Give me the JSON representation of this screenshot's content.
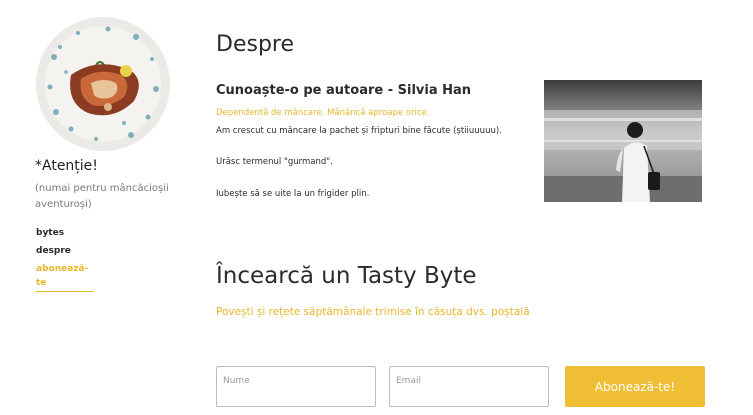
{
  "sidebar": {
    "brand": "*Atenție!",
    "tagline": "(numai pentru mâncăcioșii aventuroși)",
    "nav": [
      {
        "label": "bytes"
      },
      {
        "label": "despre"
      },
      {
        "label": "abonează-te"
      }
    ]
  },
  "about": {
    "title": "Despre",
    "subtitle": "Cunoaște-o pe autoare - Silvia Han",
    "highlight": "Dependentă de mâncare. Mănâncă aproape orice.",
    "lines": [
      "Am crescut cu mâncare la pachet și fripturi bine făcute (știiuuuuu).",
      "Urăsc termenul \"gurmand\".",
      "Iubește să se uite la un frigider plin."
    ]
  },
  "subscribe": {
    "title": "Încearcă un Tasty Byte",
    "description": "Povești și rețete săptămânale trimise în căsuța dvs. poștală",
    "name_placeholder": "Nume",
    "email_placeholder": "Email",
    "button_label": "Abonează-te!"
  },
  "colors": {
    "accent": "#e8b72c",
    "button": "#efbe34"
  }
}
